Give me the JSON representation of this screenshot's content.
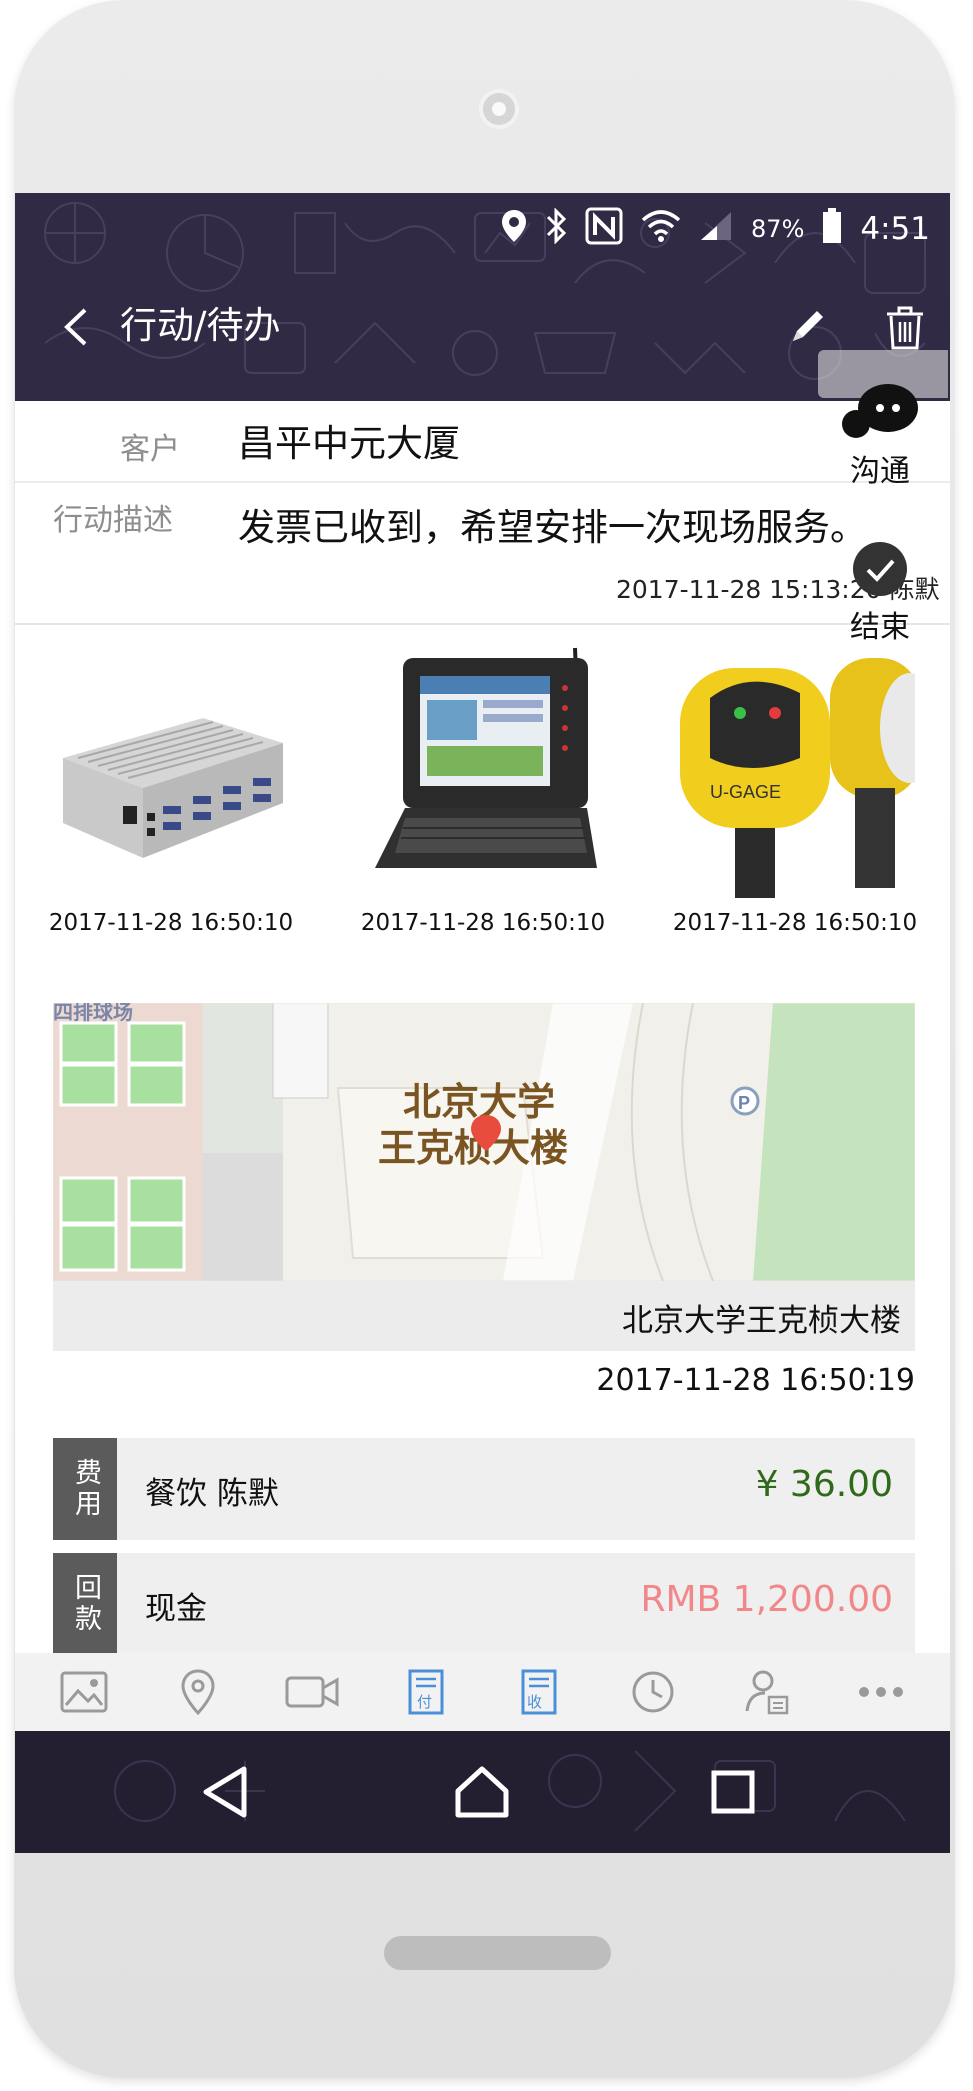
{
  "status_bar": {
    "battery_pct": "87%",
    "clock": "4:51",
    "icons": [
      "location-icon",
      "bluetooth-icon",
      "nfc-icon",
      "wifi-icon",
      "signal-icon",
      "battery-icon"
    ]
  },
  "header": {
    "title": "行动/待办"
  },
  "detail": {
    "customer_label": "客户",
    "customer_value": "昌平中元大厦",
    "desc_label": "行动描述",
    "desc_value": "发票已收到，希望安排一次现场服务。",
    "desc_time": "2017-11-28 15:13:20 陈默"
  },
  "photos": [
    {
      "caption": "2017-11-28 16:50:10",
      "icon": "industrial-pc-image"
    },
    {
      "caption": "2017-11-28 16:50:10",
      "icon": "rugged-laptop-image"
    },
    {
      "caption": "2017-11-28 16:50:10",
      "icon": "sensor-image"
    }
  ],
  "location": {
    "map_label_line1": "北京大学",
    "map_label_line2": "王克桢大楼",
    "map_corner_label": "四排球场",
    "caption": "北京大学王克桢大楼",
    "time": "2017-11-28 16:50:19"
  },
  "cards": [
    {
      "tag": "费用",
      "text": "餐饮 陈默",
      "amount": "¥ 36.00",
      "amount_color": "#2f6a1c"
    },
    {
      "tag": "回款",
      "text": "现金",
      "amount": "RMB 1,200.00",
      "amount_color": "#f2878a"
    }
  ],
  "float_menu": {
    "chat_label": "沟通",
    "finish_label": "结束"
  },
  "toolbar": {
    "icons": [
      "image-icon",
      "location-pin-icon",
      "video-icon",
      "pay-doc-icon",
      "receive-doc-icon",
      "clock-icon",
      "user-doc-icon",
      "more-icon"
    ],
    "pay_text": "付",
    "receive_text": "收",
    "accent": "#4a90d9"
  },
  "colors": {
    "header_bg": "#312a45",
    "nav_bg": "#231f30"
  }
}
